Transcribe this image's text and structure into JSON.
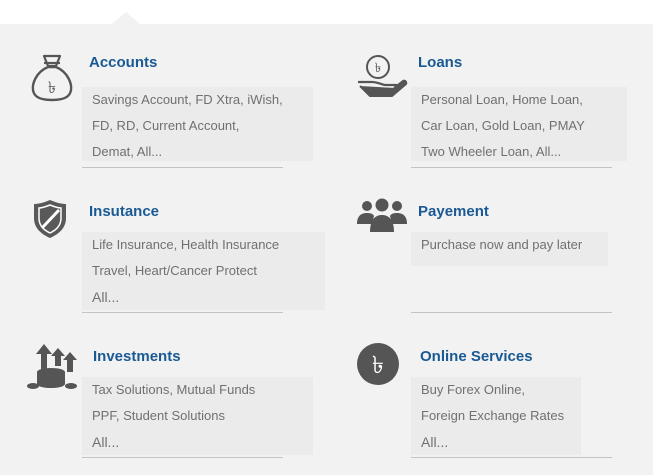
{
  "menu": {
    "accounts": {
      "icon": "money-bag-rupee-icon",
      "title": "Accounts",
      "lines": [
        "Savings Account, FD Xtra, iWish,",
        "FD, RD, Current Account,",
        "Demat, All..."
      ]
    },
    "loans": {
      "icon": "hand-holding-coin-icon",
      "title": "Loans",
      "lines": [
        "Personal Loan, Home Loan,",
        "Car Loan, Gold Loan, PMAY",
        "Two Wheeler Loan, All..."
      ]
    },
    "insurance": {
      "icon": "shield-icon",
      "title": "Insutance",
      "lines": [
        "Life Insurance, Health Insurance",
        "Travel, Heart/Cancer Protect"
      ],
      "more": "All..."
    },
    "payment": {
      "icon": "people-group-icon",
      "title": "Payement",
      "lines": [
        "Purchase now and pay later"
      ]
    },
    "investments": {
      "icon": "coins-growth-icon",
      "title": "Investments",
      "lines": [
        "Tax Solutions, Mutual Funds",
        "PPF, Student Solutions"
      ],
      "more": "All..."
    },
    "online_services": {
      "icon": "rupee-circle-icon",
      "title": "Online Services",
      "lines": [
        "Buy Forex Online,",
        "Foreign Exchange Rates"
      ],
      "more": "All..."
    }
  }
}
